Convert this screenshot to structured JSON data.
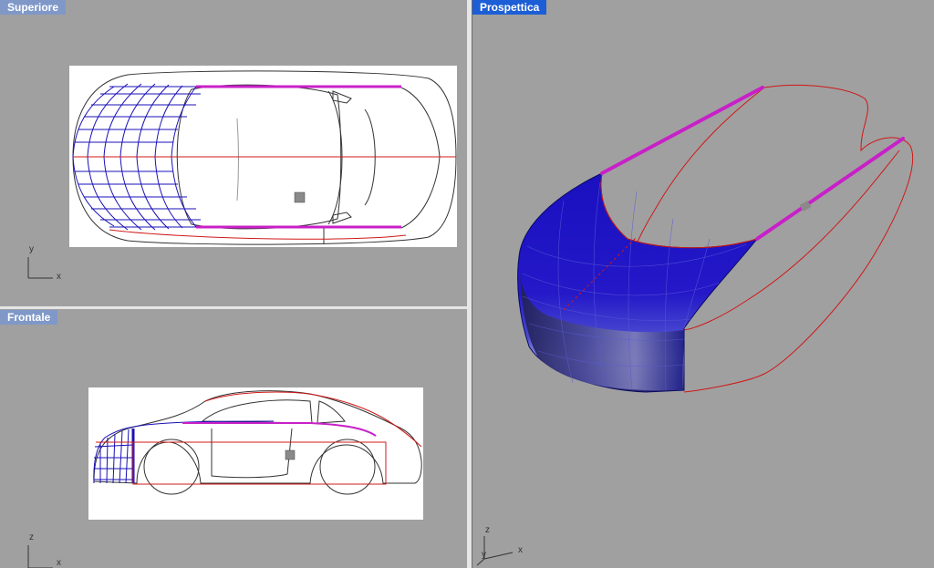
{
  "viewports": {
    "top": {
      "label": "Superiore",
      "axis_a": "y",
      "axis_b": "x"
    },
    "front": {
      "label": "Frontale",
      "axis_a": "z",
      "axis_b": "x"
    },
    "perspective": {
      "label": "Prospettica",
      "axis_a": "z",
      "axis_b": "y",
      "axis_c": "x"
    }
  },
  "colors": {
    "viewport_bg": "#a0a0a0",
    "label_inactive": "#7f98c8",
    "label_active": "#1c5ed6",
    "surface_blue": "#1a10b8",
    "curve_red": "#d01818",
    "curve_magenta": "#c820c8"
  }
}
